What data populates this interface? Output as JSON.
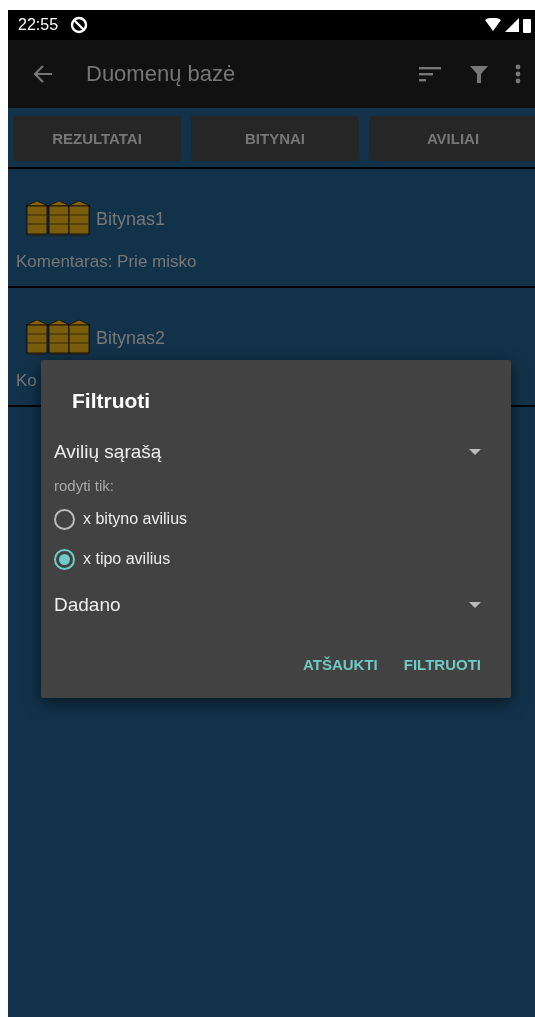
{
  "status_bar": {
    "time": "22:55"
  },
  "app_bar": {
    "title": "Duomenų bazė"
  },
  "tabs": [
    {
      "label": "REZULTATAI",
      "selected": false
    },
    {
      "label": "BITYNAI",
      "selected": false
    },
    {
      "label": "AVILIAI",
      "selected": false
    }
  ],
  "apiaries": [
    {
      "name": "Bitynas1",
      "comment": "Komentaras: Prie misko"
    },
    {
      "name": "Bitynas2",
      "comment": "Ko"
    }
  ],
  "dialog": {
    "title": "Filtruoti",
    "dropdown_1": "Avilių sąrašą",
    "hint": "rodyti tik:",
    "options": [
      {
        "label": "x bityno avilius",
        "selected": false
      },
      {
        "label": "x tipo avilius",
        "selected": true
      }
    ],
    "dropdown_2": "Dadano",
    "buttons": [
      "ATŠAUKTI",
      "FILTRUOTI"
    ]
  }
}
